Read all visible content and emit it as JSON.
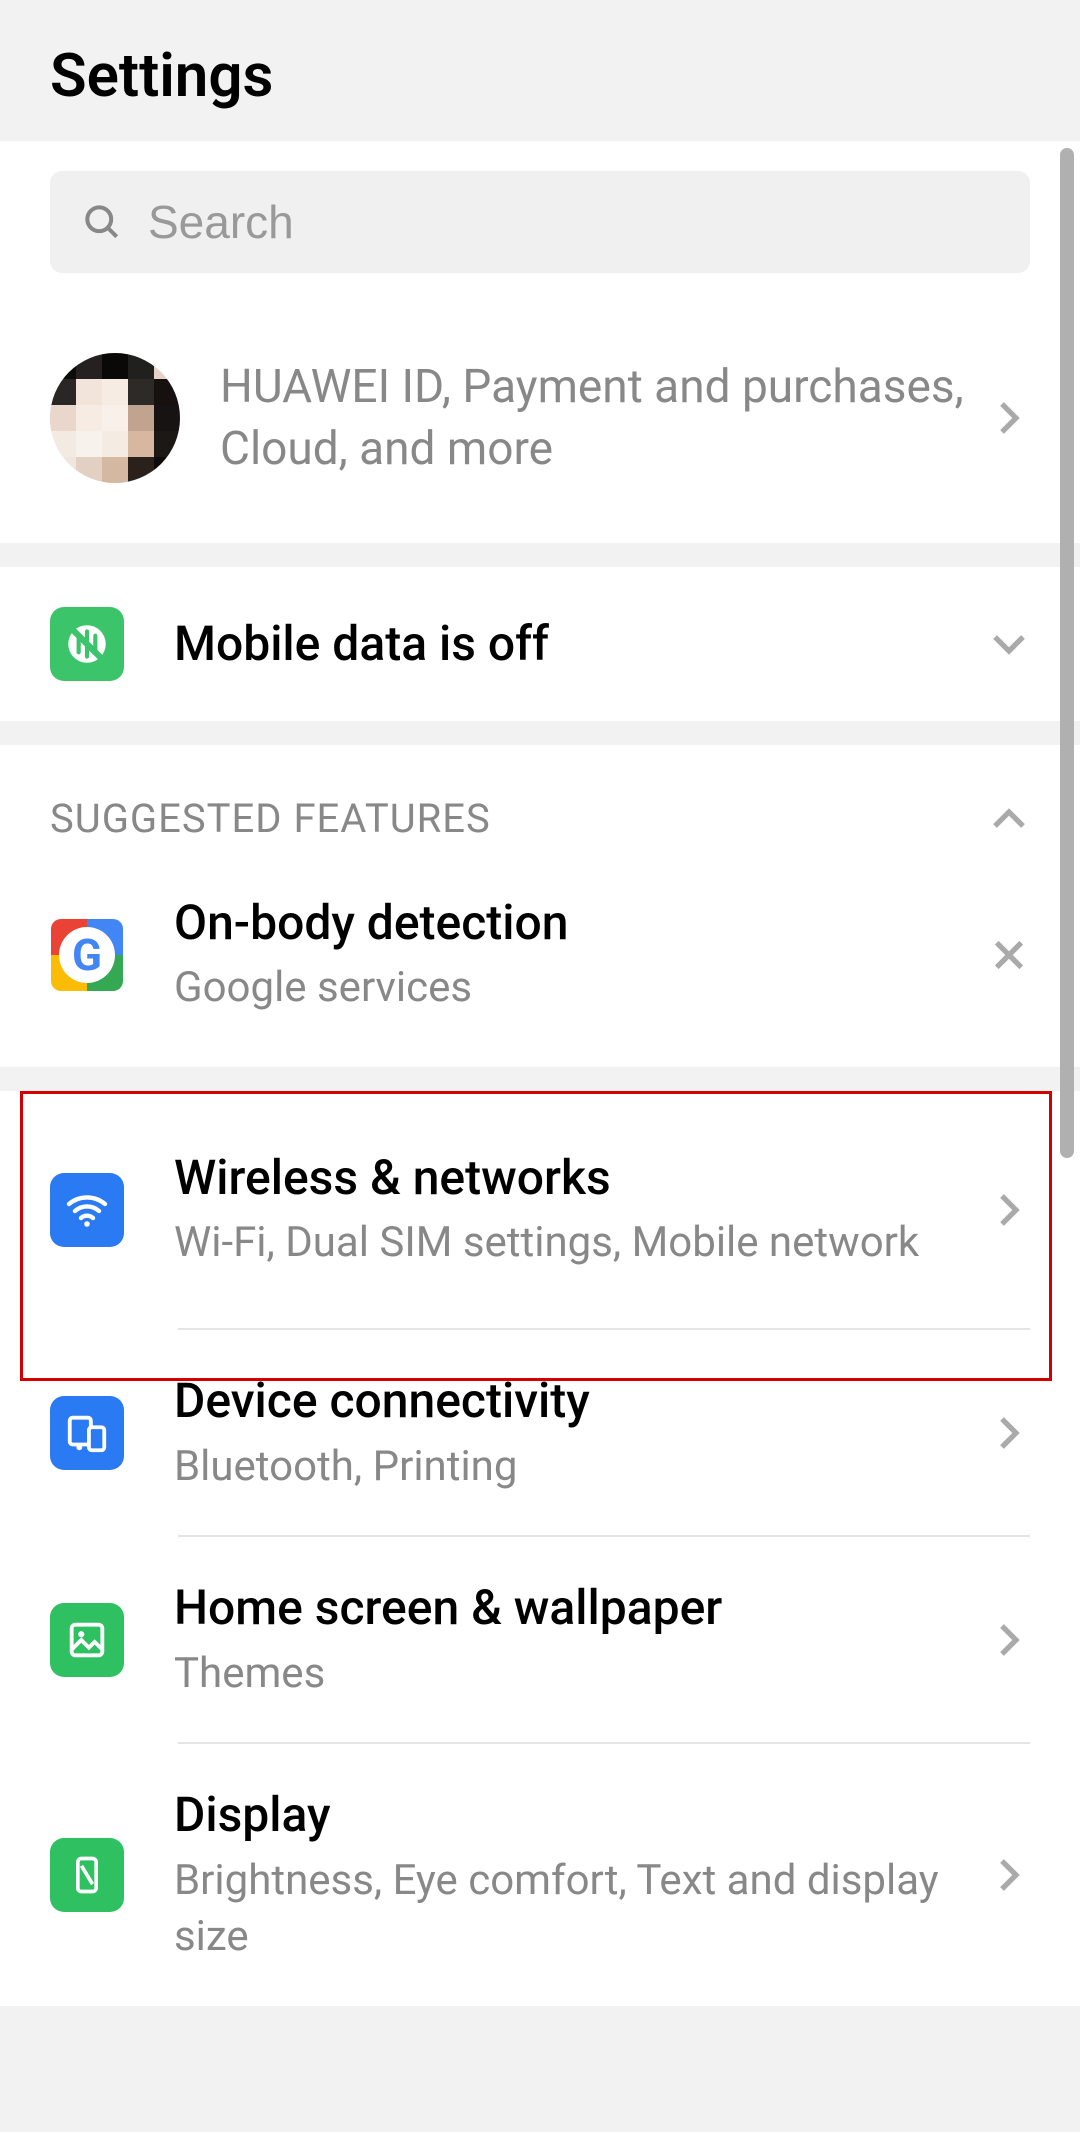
{
  "header": {
    "title": "Settings"
  },
  "search": {
    "placeholder": "Search"
  },
  "account": {
    "subtitle": "HUAWEI ID, Payment and purchases, Cloud, and more"
  },
  "notice": {
    "title": "Mobile data is off",
    "icon_color": "#3cc46b"
  },
  "suggested": {
    "header": "SUGGESTED FEATURES",
    "item": {
      "title": "On-body detection",
      "subtitle": "Google services"
    }
  },
  "settings": [
    {
      "title": "Wireless & networks",
      "subtitle": "Wi-Fi, Dual SIM settings, Mobile network",
      "icon_bg": "#2a7af3"
    },
    {
      "title": "Device connectivity",
      "subtitle": "Bluetooth, Printing",
      "icon_bg": "#2a7af3"
    },
    {
      "title": "Home screen & wallpaper",
      "subtitle": "Themes",
      "icon_bg": "#2fc062"
    },
    {
      "title": "Display",
      "subtitle": "Brightness, Eye comfort, Text and display size",
      "icon_bg": "#2fc062"
    }
  ]
}
